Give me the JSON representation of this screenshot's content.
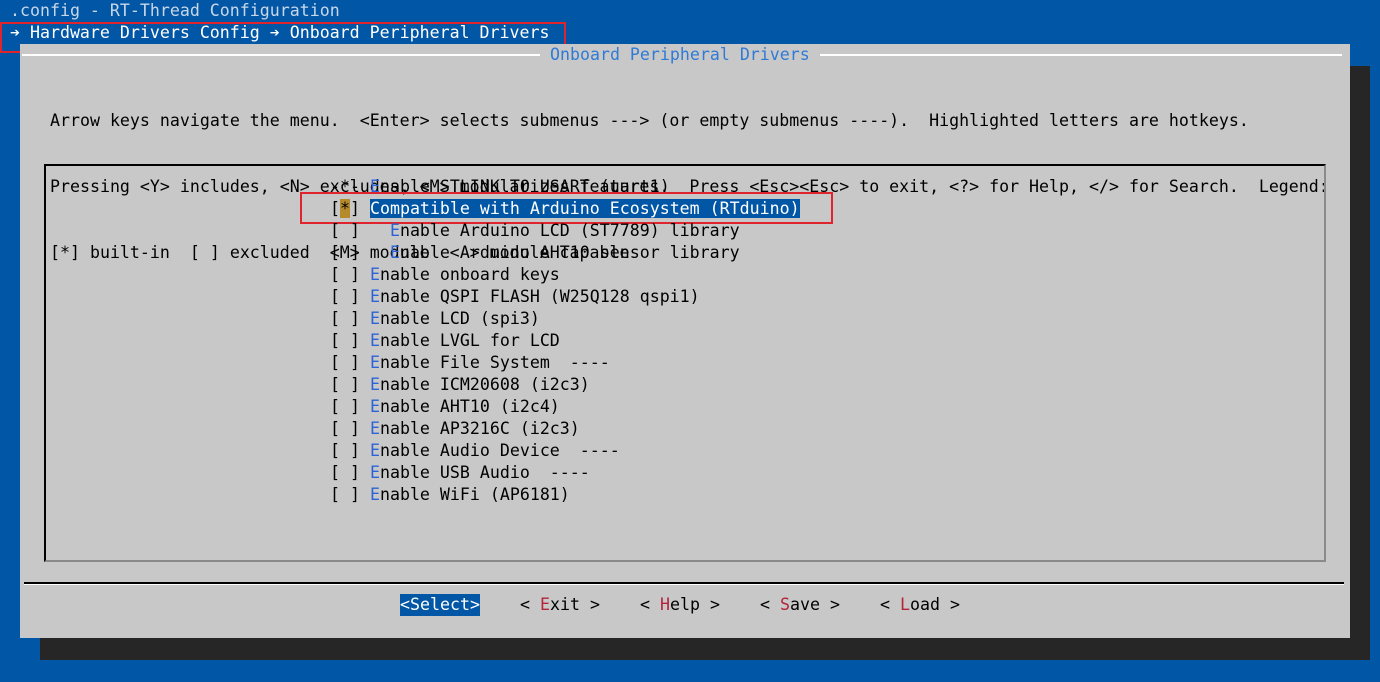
{
  "window": {
    "title": ".config - RT-Thread Configuration",
    "breadcrumb": "➔ Hardware Drivers Config ➔ Onboard Peripheral Drivers"
  },
  "dialog": {
    "title": "Onboard Peripheral Drivers",
    "help_lines": [
      "Arrow keys navigate the menu.  <Enter> selects submenus ---> (or empty submenus ----).  Highlighted letters are hotkeys.",
      "Pressing <Y> includes, <N> excludes, <M> modularizes features.  Press <Esc><Esc> to exit, <?> for Help, </> for Search.  Legend:",
      "[*] built-in  [ ] excluded  <M> module  < > module capable"
    ]
  },
  "menu": {
    "items": [
      {
        "prefix": "-*- ",
        "hotkey": "E",
        "rest": "nable STLINK TO USART (uart1)"
      },
      {
        "prefix_a": "[",
        "cursor": "*",
        "prefix_b": "] ",
        "text": "Compatible with Arduino Ecosystem (RTduino)",
        "selected": true
      },
      {
        "prefix": "[ ]   ",
        "hotkey": "E",
        "rest": "nable Arduino LCD (ST7789) library"
      },
      {
        "prefix": "[ ]   ",
        "hotkey": "E",
        "rest": "nable Arduino AHT10 sensor library"
      },
      {
        "prefix": "[ ] ",
        "hotkey": "E",
        "rest": "nable onboard keys"
      },
      {
        "prefix": "[ ] ",
        "hotkey": "E",
        "rest": "nable QSPI FLASH (W25Q128 qspi1)"
      },
      {
        "prefix": "[ ] ",
        "hotkey": "E",
        "rest": "nable LCD (spi3)"
      },
      {
        "prefix": "[ ] ",
        "hotkey": "E",
        "rest": "nable LVGL for LCD"
      },
      {
        "prefix": "[ ] ",
        "hotkey": "E",
        "rest": "nable File System  ----"
      },
      {
        "prefix": "[ ] ",
        "hotkey": "E",
        "rest": "nable ICM20608 (i2c3)"
      },
      {
        "prefix": "[ ] ",
        "hotkey": "E",
        "rest": "nable AHT10 (i2c4)"
      },
      {
        "prefix": "[ ] ",
        "hotkey": "E",
        "rest": "nable AP3216C (i2c3)"
      },
      {
        "prefix": "[ ] ",
        "hotkey": "E",
        "rest": "nable Audio Device  ----"
      },
      {
        "prefix": "[ ] ",
        "hotkey": "E",
        "rest": "nable USB Audio  ----"
      },
      {
        "prefix": "[ ] ",
        "hotkey": "E",
        "rest": "nable WiFi (AP6181)"
      }
    ]
  },
  "buttons": {
    "select": {
      "open": "<",
      "hotkey": "S",
      "rest": "elect",
      "close": ">"
    },
    "exit": {
      "open": "< ",
      "hotkey": "E",
      "rest": "xit",
      "close": " >"
    },
    "help": {
      "open": "< ",
      "hotkey": "H",
      "rest": "elp",
      "close": " >"
    },
    "save": {
      "open": "< ",
      "hotkey": "S",
      "rest": "ave",
      "close": " >"
    },
    "load": {
      "open": "< ",
      "hotkey": "L",
      "rest": "oad",
      "close": " >"
    }
  },
  "colors": {
    "background": "#0156a6",
    "dialog": "#c8c8c8",
    "hotkey": "#2c63d6",
    "button_hotkey": "#b3243b",
    "annotation": "#e0242d"
  }
}
